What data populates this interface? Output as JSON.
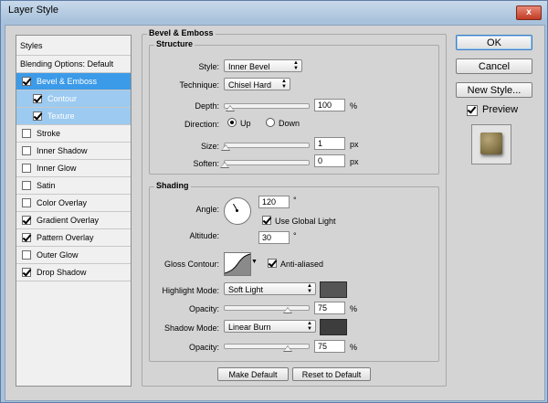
{
  "window": {
    "title": "Layer Style",
    "close_symbol": "x"
  },
  "styles_list": {
    "header": "Styles",
    "blending": "Blending Options: Default",
    "items": [
      {
        "label": "Bevel & Emboss",
        "checked": true
      },
      {
        "label": "Contour",
        "checked": true
      },
      {
        "label": "Texture",
        "checked": true
      },
      {
        "label": "Stroke",
        "checked": false
      },
      {
        "label": "Inner Shadow",
        "checked": false
      },
      {
        "label": "Inner Glow",
        "checked": false
      },
      {
        "label": "Satin",
        "checked": false
      },
      {
        "label": "Color Overlay",
        "checked": false
      },
      {
        "label": "Gradient Overlay",
        "checked": true
      },
      {
        "label": "Pattern Overlay",
        "checked": true
      },
      {
        "label": "Outer Glow",
        "checked": false
      },
      {
        "label": "Drop Shadow",
        "checked": true
      }
    ]
  },
  "bevel": {
    "section_title": "Bevel & Emboss",
    "structure": {
      "title": "Structure",
      "style_label": "Style:",
      "style_value": "Inner Bevel",
      "technique_label": "Technique:",
      "technique_value": "Chisel Hard",
      "depth_label": "Depth:",
      "depth_value": "100",
      "depth_unit": "%",
      "depth_level": 0.06,
      "direction_label": "Direction:",
      "direction_up": "Up",
      "direction_down": "Down",
      "direction_selected": "Up",
      "size_label": "Size:",
      "size_value": "1",
      "size_unit": "px",
      "size_level": 0.01,
      "soften_label": "Soften:",
      "soften_value": "0",
      "soften_unit": "px",
      "soften_level": 0.0
    },
    "shading": {
      "title": "Shading",
      "angle_label": "Angle:",
      "angle_value": "120",
      "angle_unit": "°",
      "global_light_label": "Use Global Light",
      "global_light_checked": true,
      "altitude_label": "Altitude:",
      "altitude_value": "30",
      "altitude_unit": "°",
      "gloss_label": "Gloss Contour:",
      "anti_aliased_label": "Anti-aliased",
      "anti_aliased_checked": true,
      "highlight_label": "Highlight Mode:",
      "highlight_value": "Soft Light",
      "highlight_color": "#555555",
      "highlight_opacity_label": "Opacity:",
      "highlight_opacity_value": "75",
      "highlight_opacity_unit": "%",
      "highlight_opacity_level": 0.75,
      "shadow_label": "Shadow Mode:",
      "shadow_value": "Linear Burn",
      "shadow_color": "#3d3d3d",
      "shadow_opacity_label": "Opacity:",
      "shadow_opacity_value": "75",
      "shadow_opacity_unit": "%",
      "shadow_opacity_level": 0.75
    },
    "make_default": "Make Default",
    "reset_default": "Reset to Default"
  },
  "actions": {
    "ok": "OK",
    "cancel": "Cancel",
    "new_style": "New Style...",
    "preview_label": "Preview",
    "preview_checked": true
  }
}
